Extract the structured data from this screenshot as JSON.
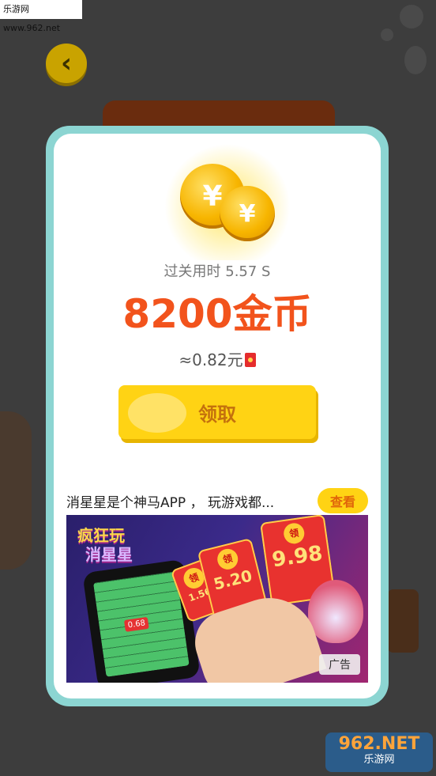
{
  "watermark_top": "乐游网 www.962.net",
  "back_icon": "chevron-left-icon",
  "result": {
    "time_label": "过关用时 5.57 S",
    "coins": "8200金币",
    "yuan": "≈0.82元"
  },
  "claim_label": "领取",
  "ad": {
    "title": "消星星是个神马APP ， 玩游戏都...",
    "view_label": "查看",
    "badge": "广告",
    "brand_line1": "疯狂玩",
    "brand_line2": "消星星",
    "grid_value": "0.68",
    "packet_small": "1.56",
    "packet_mid": "5.20",
    "packet_big": "9.98",
    "packet_char": "领"
  },
  "watermark_bottom": {
    "number": "962.NET",
    "text": "乐游网"
  },
  "colors": {
    "modal_border": "#8cd5d2",
    "amount": "#f2531c",
    "button": "#ffd314"
  }
}
